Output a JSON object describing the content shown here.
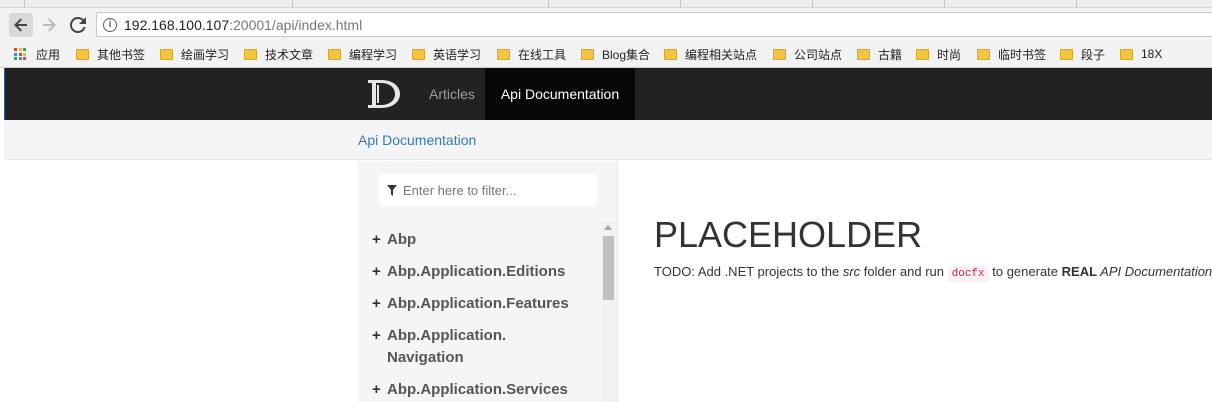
{
  "browser": {
    "url_host": "192.168.100.107",
    "url_rest": ":20001/api/index.html",
    "bookmarks": [
      {
        "label": "应用",
        "icon": "apps-grid-icon"
      },
      {
        "label": "其他书签",
        "icon": "folder-icon"
      },
      {
        "label": "绘画学习",
        "icon": "folder-icon"
      },
      {
        "label": "技术文章",
        "icon": "folder-icon"
      },
      {
        "label": "编程学习",
        "icon": "folder-icon"
      },
      {
        "label": "英语学习",
        "icon": "folder-icon"
      },
      {
        "label": "在线工具",
        "icon": "folder-icon"
      },
      {
        "label": "Blog集合",
        "icon": "folder-icon"
      },
      {
        "label": "编程相关站点",
        "icon": "folder-icon"
      },
      {
        "label": "公司站点",
        "icon": "folder-icon"
      },
      {
        "label": "古籍",
        "icon": "folder-icon"
      },
      {
        "label": "时尚",
        "icon": "folder-icon"
      },
      {
        "label": "临时书签",
        "icon": "folder-icon"
      },
      {
        "label": "段子",
        "icon": "folder-icon"
      },
      {
        "label": "18X",
        "icon": "folder-icon"
      }
    ]
  },
  "navbar": {
    "logo": "D",
    "items": [
      "Articles",
      "Api Documentation"
    ],
    "active": "Api Documentation"
  },
  "breadcrumb": "Api Documentation",
  "sidebar": {
    "filter_placeholder": "Enter here to filter...",
    "toc": [
      {
        "label": "Abp"
      },
      {
        "label": "Abp.Application.Editions"
      },
      {
        "label": "Abp.Application.Features"
      },
      {
        "label": "Abp.Application.\nNavigation"
      },
      {
        "label": "Abp.Application.Services"
      }
    ],
    "expand_symbol": "+"
  },
  "content": {
    "title": "PLACEHOLDER",
    "todo_prefix": "TODO: Add .NET projects to the ",
    "todo_src": "src",
    "todo_mid": " folder and run ",
    "todo_code": "docfx",
    "todo_mid2": " to generate ",
    "todo_real": "REAL",
    "todo_suffix_em": " API Documentation!"
  },
  "colors": {
    "navbar_bg": "#222222",
    "navbar_active_bg": "#080808",
    "link": "#337ab7",
    "code": "#c7254e"
  }
}
